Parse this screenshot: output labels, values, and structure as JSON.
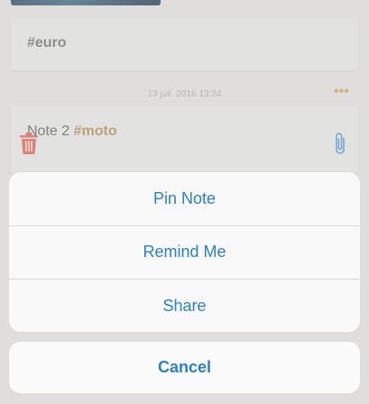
{
  "notes": {
    "euro_tag": "#euro",
    "date": "13 juil. 2016 13:24",
    "more_label": "•••",
    "note2_text": "Note 2 ",
    "note2_tag": "#moto"
  },
  "action_sheet": {
    "items": [
      "Pin Note",
      "Remind Me",
      "Share"
    ],
    "cancel_label": "Cancel"
  },
  "colors": {
    "accent": "#2a7fcf",
    "tag": "#b4864a",
    "trash": "#e05a4a"
  },
  "icons": [
    "trash-icon",
    "paperclip-icon"
  ]
}
